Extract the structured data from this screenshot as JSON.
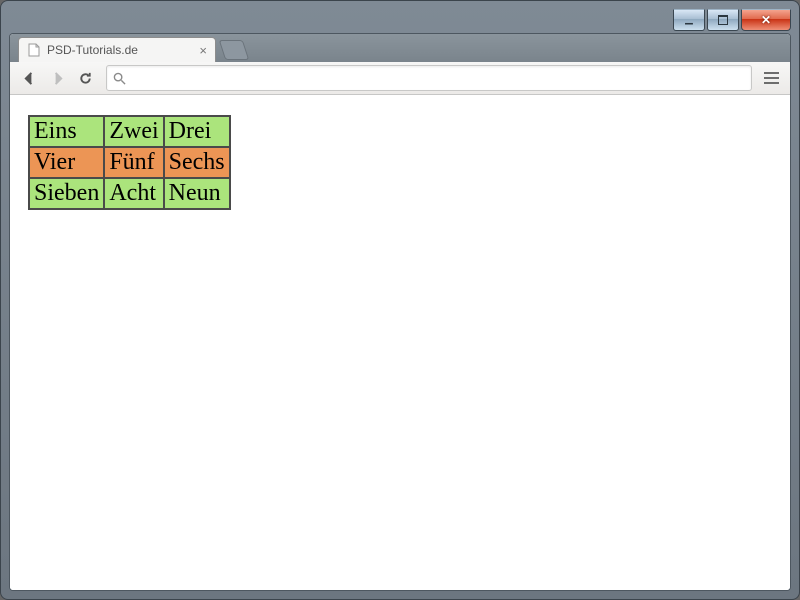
{
  "window": {
    "tab_title": "PSD-Tutorials.de"
  },
  "omnibox": {
    "value": ""
  },
  "colors": {
    "row_even": "#abe47c",
    "row_odd": "#ec9555"
  },
  "table": {
    "rows": [
      {
        "cells": [
          "Eins",
          "Zwei",
          "Drei"
        ],
        "style": "green"
      },
      {
        "cells": [
          "Vier",
          "Fünf",
          "Sechs"
        ],
        "style": "orange"
      },
      {
        "cells": [
          "Sieben",
          "Acht",
          "Neun"
        ],
        "style": "green"
      }
    ]
  }
}
